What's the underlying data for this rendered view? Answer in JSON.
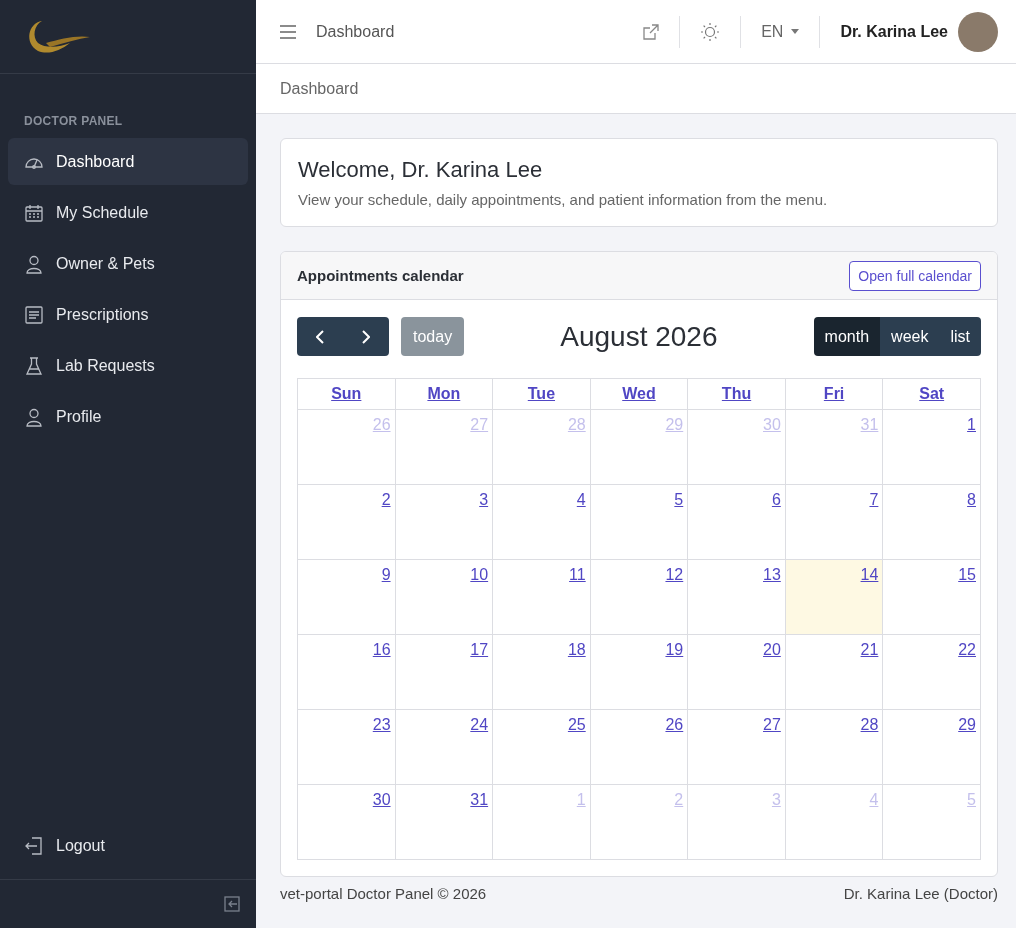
{
  "sidebar": {
    "section_title": "DOCTOR PANEL",
    "items": [
      {
        "label": "Dashboard",
        "kind": "gauge",
        "selected": true
      },
      {
        "label": "My Schedule",
        "kind": "calendar",
        "selected": false
      },
      {
        "label": "Owner & Pets",
        "kind": "person",
        "selected": false
      },
      {
        "label": "Prescriptions",
        "kind": "document",
        "selected": false
      },
      {
        "label": "Lab Requests",
        "kind": "flask",
        "selected": false
      },
      {
        "label": "Profile",
        "kind": "person",
        "selected": false
      }
    ],
    "logout": "Logout"
  },
  "header": {
    "page_title": "Dashboard",
    "language": "EN",
    "user_name": "Dr. Karina Lee"
  },
  "breadcrumb": "Dashboard",
  "welcome": {
    "title": "Welcome, Dr. Karina Lee",
    "text": "View your schedule, daily appointments, and patient information from the menu."
  },
  "calendar": {
    "title": "Appointments calendar",
    "open_button": "Open full calendar",
    "today_button": "today",
    "month_title": "August 2026",
    "views": [
      {
        "label": "month",
        "selected": true
      },
      {
        "label": "week",
        "selected": false
      },
      {
        "label": "list",
        "selected": false
      }
    ],
    "weekdays": [
      "Sun",
      "Mon",
      "Tue",
      "Wed",
      "Thu",
      "Fri",
      "Sat"
    ],
    "weeks": [
      [
        {
          "day": "26",
          "other_month": true,
          "today": false
        },
        {
          "day": "27",
          "other_month": true,
          "today": false
        },
        {
          "day": "28",
          "other_month": true,
          "today": false
        },
        {
          "day": "29",
          "other_month": true,
          "today": false
        },
        {
          "day": "30",
          "other_month": true,
          "today": false
        },
        {
          "day": "31",
          "other_month": true,
          "today": false
        },
        {
          "day": "1",
          "other_month": false,
          "today": false
        }
      ],
      [
        {
          "day": "2",
          "other_month": false,
          "today": false
        },
        {
          "day": "3",
          "other_month": false,
          "today": false
        },
        {
          "day": "4",
          "other_month": false,
          "today": false
        },
        {
          "day": "5",
          "other_month": false,
          "today": false
        },
        {
          "day": "6",
          "other_month": false,
          "today": false
        },
        {
          "day": "7",
          "other_month": false,
          "today": false
        },
        {
          "day": "8",
          "other_month": false,
          "today": false
        }
      ],
      [
        {
          "day": "9",
          "other_month": false,
          "today": false
        },
        {
          "day": "10",
          "other_month": false,
          "today": false
        },
        {
          "day": "11",
          "other_month": false,
          "today": false
        },
        {
          "day": "12",
          "other_month": false,
          "today": false
        },
        {
          "day": "13",
          "other_month": false,
          "today": false
        },
        {
          "day": "14",
          "other_month": false,
          "today": true
        },
        {
          "day": "15",
          "other_month": false,
          "today": false
        }
      ],
      [
        {
          "day": "16",
          "other_month": false,
          "today": false
        },
        {
          "day": "17",
          "other_month": false,
          "today": false
        },
        {
          "day": "18",
          "other_month": false,
          "today": false
        },
        {
          "day": "19",
          "other_month": false,
          "today": false
        },
        {
          "day": "20",
          "other_month": false,
          "today": false
        },
        {
          "day": "21",
          "other_month": false,
          "today": false
        },
        {
          "day": "22",
          "other_month": false,
          "today": false
        }
      ],
      [
        {
          "day": "23",
          "other_month": false,
          "today": false
        },
        {
          "day": "24",
          "other_month": false,
          "today": false
        },
        {
          "day": "25",
          "other_month": false,
          "today": false
        },
        {
          "day": "26",
          "other_month": false,
          "today": false
        },
        {
          "day": "27",
          "other_month": false,
          "today": false
        },
        {
          "day": "28",
          "other_month": false,
          "today": false
        },
        {
          "day": "29",
          "other_month": false,
          "today": false
        }
      ],
      [
        {
          "day": "30",
          "other_month": false,
          "today": false
        },
        {
          "day": "31",
          "other_month": false,
          "today": false
        },
        {
          "day": "1",
          "other_month": true,
          "today": false
        },
        {
          "day": "2",
          "other_month": true,
          "today": false
        },
        {
          "day": "3",
          "other_month": true,
          "today": false
        },
        {
          "day": "4",
          "other_month": true,
          "today": false
        },
        {
          "day": "5",
          "other_month": true,
          "today": false
        }
      ]
    ]
  },
  "footer": {
    "left": "vet-portal Doctor Panel © 2026",
    "right": "Dr. Karina Lee (Doctor)"
  }
}
